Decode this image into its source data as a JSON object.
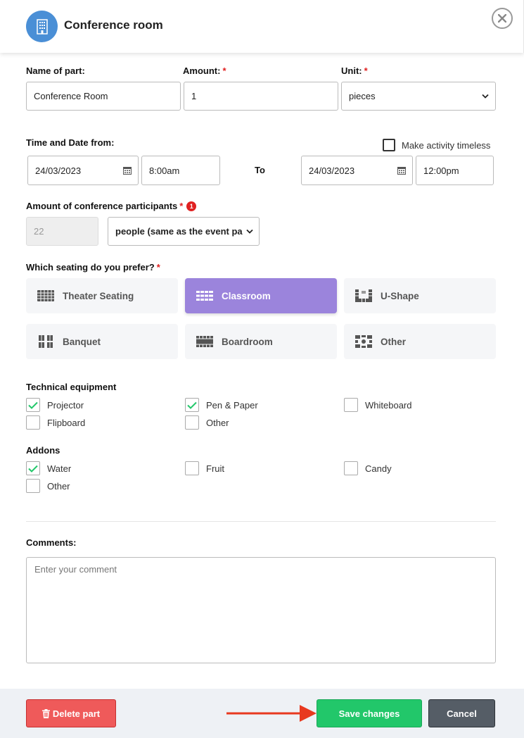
{
  "header": {
    "title": "Conference room"
  },
  "part": {
    "name_label": "Name of part:",
    "name_value": "Conference Room",
    "amount_label": "Amount:",
    "amount_value": "1",
    "unit_label": "Unit:",
    "unit_value": "pieces",
    "required_mark": "*"
  },
  "time": {
    "label": "Time and Date from:",
    "timeless_label": "Make activity timeless",
    "from_date": "24/03/2023",
    "from_time": "8:00am",
    "to_label": "To",
    "to_date": "24/03/2023",
    "to_time": "12:00pm"
  },
  "participants": {
    "label": "Amount of conference participants",
    "badge": "1",
    "value": "22",
    "unit": "people (same as the event pa"
  },
  "seating": {
    "label": "Which seating do you prefer?",
    "options": [
      {
        "label": "Theater Seating",
        "icon": "theater-seating-icon"
      },
      {
        "label": "Classroom",
        "icon": "classroom-icon",
        "selected": true
      },
      {
        "label": "U-Shape",
        "icon": "u-shape-icon"
      },
      {
        "label": "Banquet",
        "icon": "banquet-icon"
      },
      {
        "label": "Boardroom",
        "icon": "boardroom-icon"
      },
      {
        "label": "Other",
        "icon": "other-seating-icon"
      }
    ]
  },
  "equipment": {
    "label": "Technical equipment",
    "items": [
      {
        "label": "Projector",
        "checked": true
      },
      {
        "label": "Pen & Paper",
        "checked": true
      },
      {
        "label": "Whiteboard",
        "checked": false
      },
      {
        "label": "Flipboard",
        "checked": false
      },
      {
        "label": "Other",
        "checked": false
      }
    ]
  },
  "addons": {
    "label": "Addons",
    "items": [
      {
        "label": "Water",
        "checked": true
      },
      {
        "label": "Fruit",
        "checked": false
      },
      {
        "label": "Candy",
        "checked": false
      },
      {
        "label": "Other",
        "checked": false
      }
    ]
  },
  "comments": {
    "label": "Comments:",
    "placeholder": "Enter your comment"
  },
  "footer": {
    "delete_label": "Delete part",
    "save_label": "Save changes",
    "cancel_label": "Cancel"
  },
  "colors": {
    "accent": "#9b84dc",
    "save": "#22c76a",
    "delete": "#ef5a5a",
    "cancel": "#555d66",
    "check": "#22c76a",
    "required": "#e02020"
  }
}
